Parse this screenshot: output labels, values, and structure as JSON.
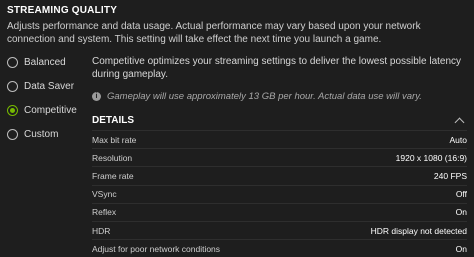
{
  "section": {
    "title": "STREAMING QUALITY",
    "description": "Adjusts performance and data usage. Actual performance may vary based upon your network connection and system. This setting will take effect the next time you launch a game."
  },
  "options": [
    {
      "label": "Balanced",
      "selected": false
    },
    {
      "label": "Data Saver",
      "selected": false
    },
    {
      "label": "Competitive",
      "selected": true
    },
    {
      "label": "Custom",
      "selected": false
    }
  ],
  "competitive": {
    "description": "Competitive optimizes your streaming settings to deliver the lowest possible latency during gameplay.",
    "note": "Gameplay will use approximately 13 GB per hour. Actual data use will vary.",
    "note_icon": "info-icon"
  },
  "details": {
    "title": "DETAILS",
    "expanded": true,
    "rows": [
      {
        "label": "Max bit rate",
        "value": "Auto"
      },
      {
        "label": "Resolution",
        "value": "1920 x 1080 (16:9)"
      },
      {
        "label": "Frame rate",
        "value": "240 FPS"
      },
      {
        "label": "VSync",
        "value": "Off"
      },
      {
        "label": "Reflex",
        "value": "On"
      },
      {
        "label": "HDR",
        "value": "HDR display not detected"
      },
      {
        "label": "Adjust for poor network conditions",
        "value": "On"
      }
    ]
  },
  "colors": {
    "accent": "#76b900",
    "background": "#1e1e1e"
  }
}
